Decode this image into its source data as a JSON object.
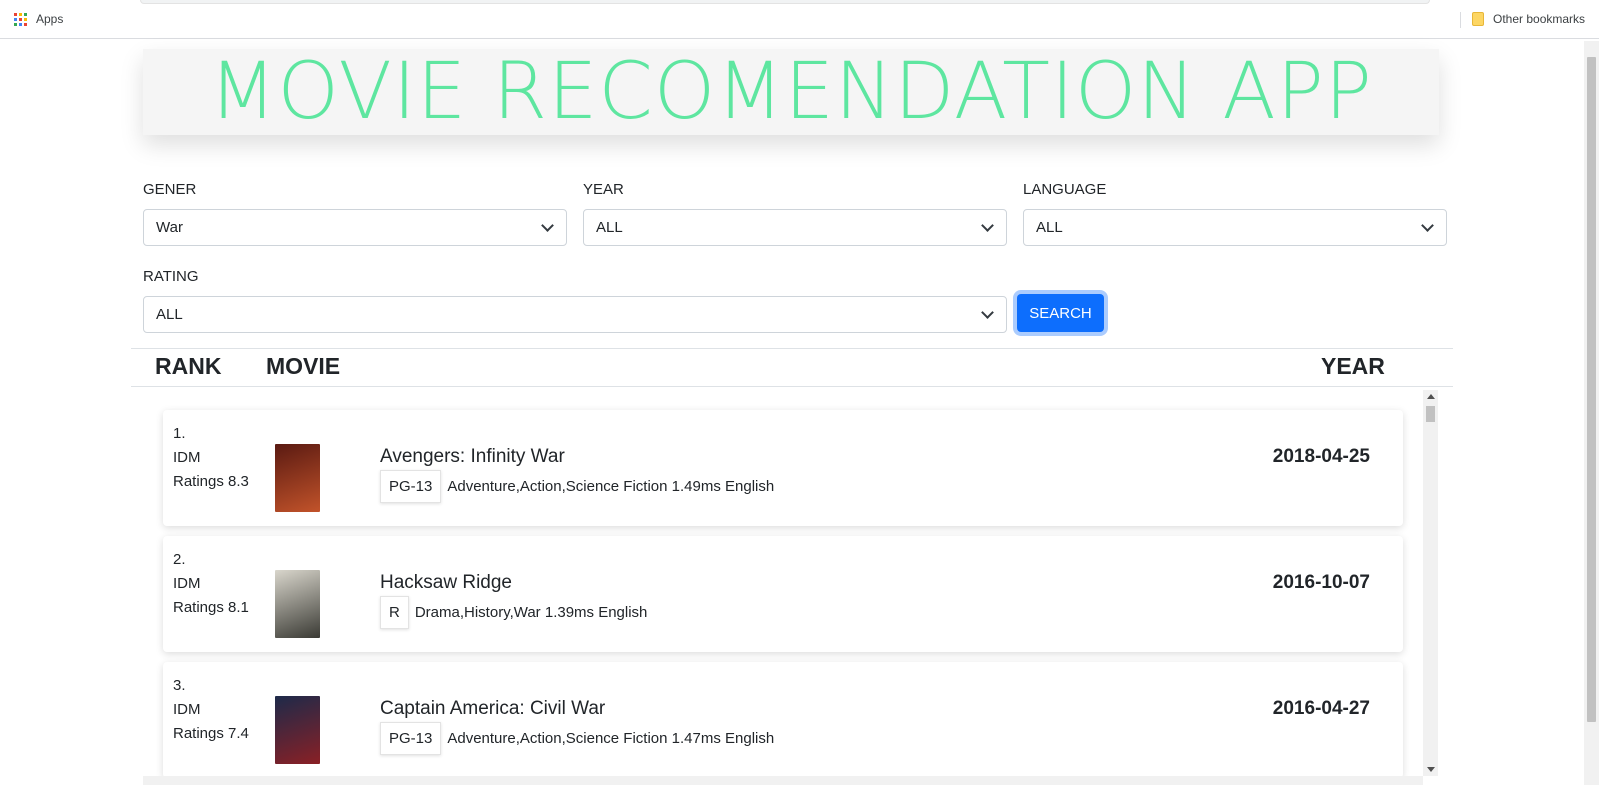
{
  "bookmarks_bar": {
    "apps_label": "Apps",
    "apps_icon": "apps-grid-icon",
    "other_bookmarks_label": "Other bookmarks",
    "folder_icon": "folder-icon",
    "apps_dot_colors": [
      "#ea4335",
      "#fbbc04",
      "#34a853",
      "#4285f4",
      "#ea4335",
      "#fbbc04",
      "#34a853",
      "#4285f4",
      "#ea4335"
    ]
  },
  "header": {
    "title": "MOVIE RECOMENDATION APP",
    "title_color": "#5ee6a0"
  },
  "filters": {
    "genre": {
      "label": "GENER",
      "value": "War"
    },
    "year": {
      "label": "YEAR",
      "value": "ALL"
    },
    "language": {
      "label": "LANGUAGE",
      "value": "ALL"
    },
    "rating": {
      "label": "RATING",
      "value": "ALL"
    },
    "search_button": "SEARCH"
  },
  "table": {
    "headers": {
      "rank": "RANK",
      "movie": "MOVIE",
      "year": "YEAR"
    },
    "rows": [
      {
        "rank": "1.",
        "rating_source": "IDM",
        "rating_text": "Ratings 8.3",
        "title": "Avengers: Infinity War",
        "certification": "PG-13",
        "details": "Adventure,Action,Science Fiction 1.49ms English",
        "date": "2018-04-25",
        "poster_colors": [
          "#5a1a12",
          "#c2532a"
        ]
      },
      {
        "rank": "2.",
        "rating_source": "IDM",
        "rating_text": "Ratings 8.1",
        "title": "Hacksaw Ridge",
        "certification": "R",
        "details": "Drama,History,War 1.39ms English",
        "date": "2016-10-07",
        "poster_colors": [
          "#d9d6cc",
          "#3a3a34"
        ]
      },
      {
        "rank": "3.",
        "rating_source": "IDM",
        "rating_text": "Ratings 7.4",
        "title": "Captain America: Civil War",
        "certification": "PG-13",
        "details": "Adventure,Action,Science Fiction 1.47ms English",
        "date": "2016-04-27",
        "poster_colors": [
          "#1d2a4a",
          "#8a2025"
        ]
      }
    ]
  }
}
